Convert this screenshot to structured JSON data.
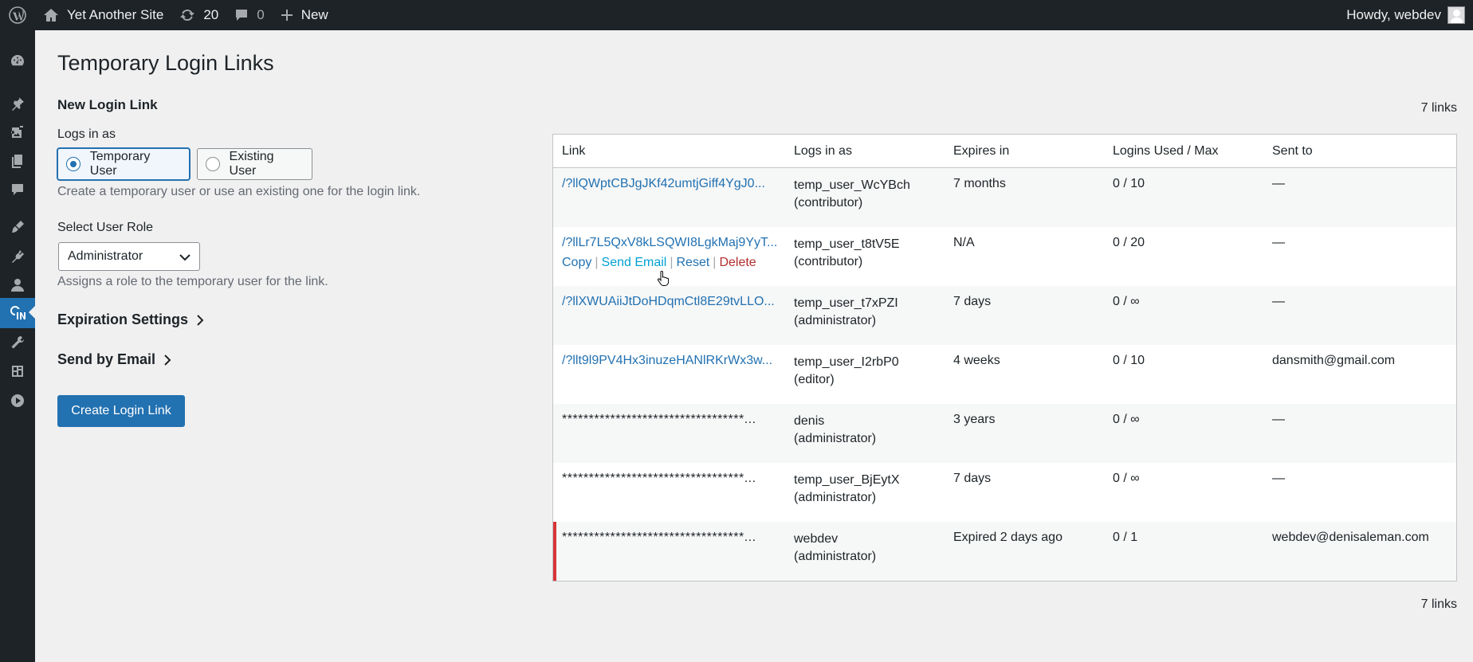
{
  "adminbar": {
    "site_name": "Yet Another Site",
    "updates_count": "20",
    "comments_count": "0",
    "new_label": "New",
    "howdy": "Howdy, webdev"
  },
  "sidebar": {
    "items": [
      {
        "name": "dashboard-icon"
      },
      {
        "name": "posts-pin-icon"
      },
      {
        "name": "media-icon"
      },
      {
        "name": "pages-icon"
      },
      {
        "name": "comments-icon"
      },
      {
        "name": "appearance-brush-icon"
      },
      {
        "name": "plugins-icon"
      },
      {
        "name": "users-icon"
      },
      {
        "name": "temporary-login-icon",
        "current": true
      },
      {
        "name": "tools-wrench-icon"
      },
      {
        "name": "settings-icon"
      },
      {
        "name": "play-icon"
      }
    ]
  },
  "page": {
    "title": "Temporary Login Links",
    "form": {
      "heading": "New Login Link",
      "logs_in_as_label": "Logs in as",
      "option_temporary": "Temporary User",
      "option_existing": "Existing User",
      "logs_in_as_desc": "Create a temporary user or use an existing one for the login link.",
      "role_label": "Select User Role",
      "role_value": "Administrator",
      "role_desc": "Assigns a role to the temporary user for the link.",
      "expiration_toggle": "Expiration Settings",
      "email_toggle": "Send by Email",
      "create_button": "Create Login Link"
    },
    "count_top": "7 links",
    "count_bottom": "7 links",
    "table": {
      "headers": [
        "Link",
        "Logs in as",
        "Expires in",
        "Logins Used / Max",
        "Sent to"
      ],
      "rows": [
        {
          "link": "/?llQWptCBJgJKf42umtjGiff4YgJ0...",
          "user": "temp_user_WcYBch",
          "role": "(contributor)",
          "expires": "7 months",
          "logins": "0 / 10",
          "sent": "—"
        },
        {
          "link": "/?llLr7L5QxV8kLSQWI8LgkMaj9YyT...",
          "user": "temp_user_t8tV5E",
          "role": "(contributor)",
          "expires": "N/A",
          "logins": "0 / 20",
          "sent": "—"
        },
        {
          "link": "/?llXWUAiiJtDoHDqmCtl8E29tvLLO...",
          "user": "temp_user_t7xPZI",
          "role": "(administrator)",
          "expires": "7 days",
          "logins": "0 / ∞",
          "sent": "—"
        },
        {
          "link": "/?llt9l9PV4Hx3inuzeHANlRKrWx3w...",
          "user": "temp_user_I2rbP0",
          "role": "(editor)",
          "expires": "4 weeks",
          "logins": "0 / 10",
          "sent": "dansmith@gmail.com"
        },
        {
          "link": "**********************************...",
          "user": "denis",
          "role": "(administrator)",
          "expires": "3 years",
          "logins": "0 / ∞",
          "sent": "—"
        },
        {
          "link": "**********************************...",
          "user": "temp_user_BjEytX",
          "role": "(administrator)",
          "expires": "7 days",
          "logins": "0 / ∞",
          "sent": "—"
        },
        {
          "link": "**********************************...",
          "user": "webdev",
          "role": "(administrator)",
          "expires": "Expired 2 days ago",
          "logins": "0 / 1",
          "sent": "webdev@denisaleman.com"
        }
      ],
      "row_actions": {
        "copy": "Copy",
        "send_email": "Send Email",
        "reset": "Reset",
        "delete": "Delete",
        "separator": "|"
      }
    }
  }
}
